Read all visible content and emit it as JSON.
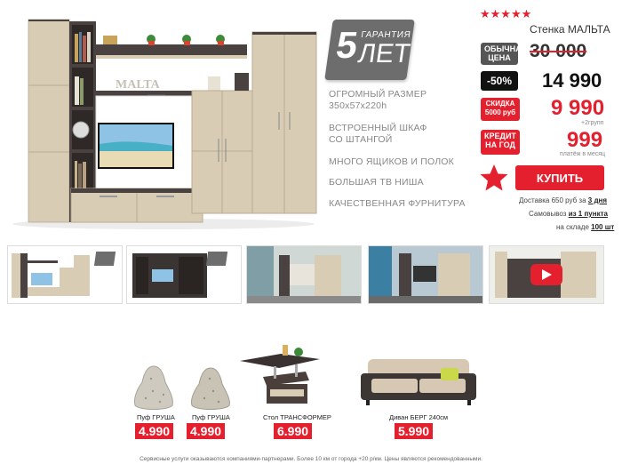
{
  "hero": {
    "brand_text": "MALTA"
  },
  "badge": {
    "number": "5",
    "top_word": "ГАРАНТИЯ",
    "bottom_word": "ЛЕТ"
  },
  "features": [
    "ОГРОМНЫЙ РАЗМЕР",
    "350x57x220h",
    "ВСТРОЕННЫЙ ШКАФ",
    "СО ШТАНГОЙ",
    "МНОГО ЯЩИКОВ И ПОЛОК",
    "БОЛЬШАЯ ТВ НИША",
    "КАЧЕСТВЕННАЯ ФУРНИТУРА"
  ],
  "product": {
    "rating_stars": "★★★★★",
    "title": "Стенка МАЛЬТА",
    "regular_label": "ОБЫЧНАЯ ЦЕНА",
    "regular_price": "30 000",
    "discount_pct": "-50%",
    "discount_price": "14 990",
    "extra_label": "СКИДКА 5000 руб",
    "extra_price": "9 990",
    "extra_note": "+2групп",
    "credit_label": "КРЕДИТ НА ГОД",
    "credit_price": "999",
    "credit_note": "платёж в месяц",
    "buy_label": "КУПИТЬ",
    "delivery_text": "Доставка 650 руб за",
    "delivery_days": "3 дня",
    "pickup_text": "Самовывоз",
    "pickup_points": "из 1 пункта",
    "stock_text": "на складе",
    "stock_count": "100 шт"
  },
  "related": [
    {
      "name": "Пуф ГРУША",
      "price": "4.990"
    },
    {
      "name": "Пуф ГРУША",
      "price": "4.990"
    },
    {
      "name": "Стол ТРАНСФОРМЕР",
      "price": "6.990"
    },
    {
      "name": "Диван БЕРГ 240см",
      "price": "5.990"
    }
  ],
  "footer": "Сервисные услуги оказываются компаниями-партнерами. Более 10 км от города +20 р/км. Цены являются рекомендованными.",
  "colors": {
    "accent": "#e5202e",
    "wood_light": "#d9ccb4",
    "wood_dark": "#4a4240"
  }
}
